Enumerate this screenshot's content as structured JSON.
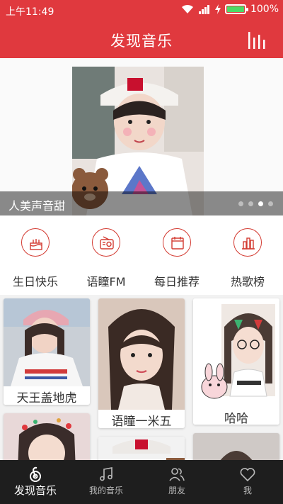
{
  "status_bar": {
    "time": "上午11:49",
    "battery": "100%",
    "battery_level": 1.0
  },
  "header": {
    "title": "发现音乐",
    "action_icon": "bars-chart-icon"
  },
  "banner": {
    "caption": "人美声音甜",
    "slide_count": 4,
    "active_slide": 3
  },
  "shortcuts": [
    {
      "label": "生日快乐",
      "icon": "cake-icon"
    },
    {
      "label": "语瞳FM",
      "icon": "radio-icon"
    },
    {
      "label": "每日推荐",
      "icon": "calendar-icon"
    },
    {
      "label": "热歌榜",
      "icon": "chart-bars-icon"
    }
  ],
  "cards": [
    {
      "label": "天王盖地虎"
    },
    {
      "label": "语瞳一米五"
    },
    {
      "label": "哈哈"
    }
  ],
  "tabs": [
    {
      "label": "发现音乐",
      "icon": "discover-icon",
      "active": true
    },
    {
      "label": "我的音乐",
      "icon": "music-note-icon",
      "active": false
    },
    {
      "label": "朋友",
      "icon": "friends-icon",
      "active": false
    },
    {
      "label": "我",
      "icon": "heart-icon",
      "active": false
    }
  ],
  "colors": {
    "accent": "#e0393e",
    "tabbar": "#1e1e1e",
    "battery_fill": "#4cd964"
  }
}
